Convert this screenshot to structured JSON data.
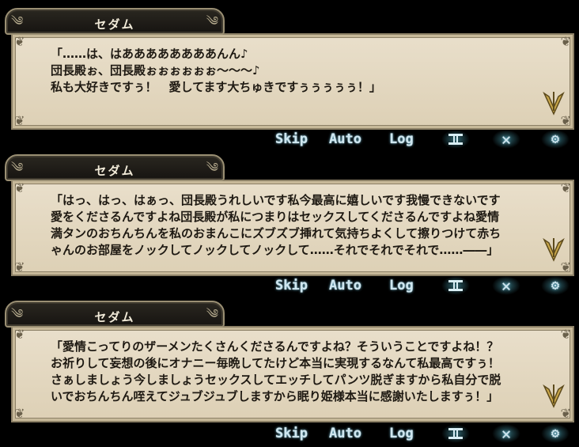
{
  "toolbar": {
    "skip_label": "Skip",
    "auto_label": "Auto",
    "log_label": "Log",
    "pause_icon": "layers-icon",
    "close_icon": "close-icon",
    "close_glyph": "✕",
    "config_icon": "gear-icon",
    "config_glyph": "⚙"
  },
  "colors": {
    "textbox_bg": "#e4d9c2",
    "name_plate_bg": "#1f1c17",
    "button_glow": "#6fb7d0"
  },
  "panels": [
    {
      "speaker": "セダム",
      "dialogue": "「……は、はああああああああんん♪\n団長殿ぉ、団長殿ぉぉぉぉぉぉ〜〜〜♪\n私も大好きですぅ！　愛してます大ちゅきですぅぅぅぅぅ！」"
    },
    {
      "speaker": "セダム",
      "dialogue": "「はっ、はっ、はぁっ、団長殿うれしいです私今最高に嬉しいです我慢できないです\n愛をくださるんですよね団長殿が私につまりはセックスしてくださるんですよね愛情\n満タンのおちんちんを私のおまんこにズブズブ挿れて気持ちよくして擦りつけて赤ち\nゃんのお部屋をノックしてノックしてノックして……それでそれでそれで……――」"
    },
    {
      "speaker": "セダム",
      "dialogue": "「愛情こってりのザーメンたくさんくださるんですよね？そういうことですよね！？\nお祈りして妄想の後にオナニー毎晩してたけど本当に実現するなんて私最高ですぅ！\nさぁしましょう今しましょうセックスしてエッチしてパンツ脱ぎますから私自分で脱\nいでおちんちん咥えてジュブジュブしますから眠り姫様本当に感謝いたしますぅ！」"
    }
  ]
}
